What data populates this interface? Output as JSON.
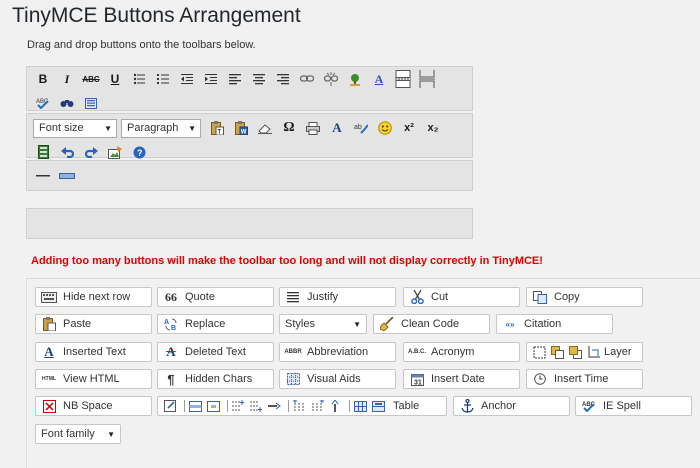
{
  "page": {
    "title": "TinyMCE Buttons Arrangement",
    "subtitle": "Drag and drop buttons onto the toolbars below.",
    "warning": "Adding too many buttons will make the toolbar too long and will not display correctly in TinyMCE!"
  },
  "toolbar1": {
    "buttons": [
      "bold-icon",
      "italic-icon",
      "strikethrough-icon",
      "underline-icon",
      "bullet-list-icon",
      "numbered-list-icon",
      "outdent-icon",
      "indent-icon",
      "align-left-icon",
      "align-center-icon",
      "align-right-icon",
      "link-icon",
      "unlink-icon",
      "image-icon",
      "help-icon",
      "page-break-icon",
      "more-break-icon"
    ],
    "bold": "B",
    "italic": "I",
    "strike": "ABC",
    "underline": "U"
  },
  "toolbar1_wrap": {
    "buttons": [
      "spellcheck-icon",
      "search-icon",
      "fullscreen-icon"
    ]
  },
  "toolbar2": {
    "fontsize": "Font size",
    "format": "Paragraph",
    "buttons": [
      "paste-text-icon",
      "paste-word-icon",
      "eraser-icon",
      "omega-icon",
      "print-icon",
      "font-color-icon",
      "spellcheck-icon",
      "emoticon-icon",
      "superscript-icon",
      "subscript-icon"
    ],
    "omega": "Ω",
    "text_color": "A",
    "sup": "x²",
    "sub": "x₂"
  },
  "toolbar2_wrap": {
    "buttons": [
      "media-icon",
      "undo-icon",
      "redo-icon",
      "edit-image-icon",
      "help-icon"
    ]
  },
  "toolbar3": {
    "buttons": [
      "horizontal-rule-icon",
      "minus-icon"
    ]
  },
  "palette": {
    "hide_next_row": "Hide next row",
    "quote": "Quote",
    "justify": "Justify",
    "cut": "Cut",
    "copy": "Copy",
    "paste": "Paste",
    "replace": "Replace",
    "styles": "Styles",
    "clean_code": "Clean Code",
    "citation": "Citation",
    "inserted_text": "Inserted Text",
    "deleted_text": "Deleted Text",
    "abbreviation": "Abbreviation",
    "acronym": "Acronym",
    "layer": "Layer",
    "view_html": "View HTML",
    "hidden_chars": "Hidden Chars",
    "visual_aids": "Visual Aids",
    "insert_date": "Insert Date",
    "insert_time": "Insert Time",
    "nb_space": "NB Space",
    "table": "Table",
    "anchor": "Anchor",
    "ie_spell": "IE Spell",
    "font_family": "Font family",
    "quote_glyph": "66",
    "html_glyph": "HTML",
    "pilcrow": "¶",
    "text_a": "A"
  },
  "colors": {
    "warning": "#e00000",
    "icon_blue": "#2a6db5",
    "toolbar_bg": "#e4e4e4"
  }
}
